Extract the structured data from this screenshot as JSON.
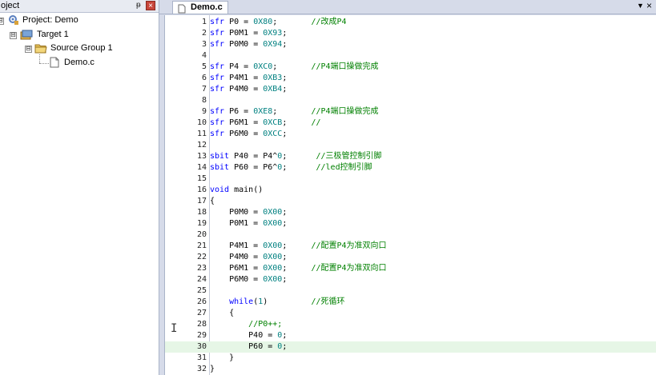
{
  "project_pane": {
    "title": "oject",
    "pin": "ᵽ",
    "close": "×",
    "tree": [
      {
        "label": "Project: Demo",
        "level": 0,
        "icon": "project-icon",
        "expander": "⊟"
      },
      {
        "label": "Target 1",
        "level": 1,
        "icon": "target-icon",
        "expander": "⊟"
      },
      {
        "label": "Source Group 1",
        "level": 2,
        "icon": "folder-icon",
        "expander": "⊟"
      },
      {
        "label": "Demo.c",
        "level": 3,
        "icon": "file-icon"
      }
    ]
  },
  "editor": {
    "tab_label": "Demo.c",
    "tab_menu": "▼",
    "tab_close": "×",
    "highlight_line": 30,
    "lines": [
      {
        "n": "1",
        "toks": [
          [
            "kw",
            "sfr "
          ],
          [
            "txt",
            "P0 = "
          ],
          [
            "num",
            "0X80"
          ],
          [
            "txt",
            ";       "
          ],
          [
            "cmt",
            "//改成P4"
          ]
        ]
      },
      {
        "n": "2",
        "toks": [
          [
            "kw",
            "sfr "
          ],
          [
            "txt",
            "P0M1 = "
          ],
          [
            "num",
            "0X93"
          ],
          [
            "txt",
            ";"
          ]
        ]
      },
      {
        "n": "3",
        "toks": [
          [
            "kw",
            "sfr "
          ],
          [
            "txt",
            "P0M0 = "
          ],
          [
            "num",
            "0X94"
          ],
          [
            "txt",
            ";"
          ]
        ]
      },
      {
        "n": "4",
        "toks": []
      },
      {
        "n": "5",
        "toks": [
          [
            "kw",
            "sfr "
          ],
          [
            "txt",
            "P4 = "
          ],
          [
            "num",
            "0XC0"
          ],
          [
            "txt",
            ";       "
          ],
          [
            "cmt",
            "//P4端口操做完成"
          ]
        ]
      },
      {
        "n": "6",
        "toks": [
          [
            "kw",
            "sfr "
          ],
          [
            "txt",
            "P4M1 = "
          ],
          [
            "num",
            "0XB3"
          ],
          [
            "txt",
            ";"
          ]
        ]
      },
      {
        "n": "7",
        "toks": [
          [
            "kw",
            "sfr "
          ],
          [
            "txt",
            "P4M0 = "
          ],
          [
            "num",
            "0XB4"
          ],
          [
            "txt",
            ";"
          ]
        ]
      },
      {
        "n": "8",
        "toks": []
      },
      {
        "n": "9",
        "toks": [
          [
            "kw",
            "sfr "
          ],
          [
            "txt",
            "P6 = "
          ],
          [
            "num",
            "0XE8"
          ],
          [
            "txt",
            ";       "
          ],
          [
            "cmt",
            "//P4端口操做完成"
          ]
        ]
      },
      {
        "n": "10",
        "toks": [
          [
            "kw",
            "sfr "
          ],
          [
            "txt",
            "P6M1 = "
          ],
          [
            "num",
            "0XCB"
          ],
          [
            "txt",
            ";     "
          ],
          [
            "cmt",
            "//"
          ]
        ]
      },
      {
        "n": "11",
        "toks": [
          [
            "kw",
            "sfr "
          ],
          [
            "txt",
            "P6M0 = "
          ],
          [
            "num",
            "0XCC"
          ],
          [
            "txt",
            ";"
          ]
        ]
      },
      {
        "n": "12",
        "toks": []
      },
      {
        "n": "13",
        "toks": [
          [
            "kw",
            "sbit "
          ],
          [
            "txt",
            "P40 = P4^"
          ],
          [
            "num",
            "0"
          ],
          [
            "txt",
            ";      "
          ],
          [
            "cmt",
            "//三极管控制引脚"
          ]
        ]
      },
      {
        "n": "14",
        "toks": [
          [
            "kw",
            "sbit "
          ],
          [
            "txt",
            "P60 = P6^"
          ],
          [
            "num",
            "0"
          ],
          [
            "txt",
            ";      "
          ],
          [
            "cmt",
            "//led控制引脚"
          ]
        ]
      },
      {
        "n": "15",
        "toks": []
      },
      {
        "n": "16",
        "toks": [
          [
            "kw",
            "void "
          ],
          [
            "txt",
            "main()"
          ]
        ]
      },
      {
        "n": "17",
        "toks": [
          [
            "txt",
            "{"
          ]
        ]
      },
      {
        "n": "18",
        "toks": [
          [
            "txt",
            "    P0M0 = "
          ],
          [
            "num",
            "0X00"
          ],
          [
            "txt",
            ";"
          ]
        ]
      },
      {
        "n": "19",
        "toks": [
          [
            "txt",
            "    P0M1 = "
          ],
          [
            "num",
            "0X00"
          ],
          [
            "txt",
            ";"
          ]
        ]
      },
      {
        "n": "20",
        "toks": []
      },
      {
        "n": "21",
        "toks": [
          [
            "txt",
            "    P4M1 = "
          ],
          [
            "num",
            "0X00"
          ],
          [
            "txt",
            ";     "
          ],
          [
            "cmt",
            "//配置P4为准双向口"
          ]
        ]
      },
      {
        "n": "22",
        "toks": [
          [
            "txt",
            "    P4M0 = "
          ],
          [
            "num",
            "0X00"
          ],
          [
            "txt",
            ";"
          ]
        ]
      },
      {
        "n": "23",
        "toks": [
          [
            "txt",
            "    P6M1 = "
          ],
          [
            "num",
            "0X00"
          ],
          [
            "txt",
            ";     "
          ],
          [
            "cmt",
            "//配置P4为准双向口"
          ]
        ]
      },
      {
        "n": "24",
        "toks": [
          [
            "txt",
            "    P6M0 = "
          ],
          [
            "num",
            "0X00"
          ],
          [
            "txt",
            ";"
          ]
        ]
      },
      {
        "n": "25",
        "toks": []
      },
      {
        "n": "26",
        "toks": [
          [
            "txt",
            "    "
          ],
          [
            "kw",
            "while"
          ],
          [
            "txt",
            "("
          ],
          [
            "num",
            "1"
          ],
          [
            "txt",
            ")         "
          ],
          [
            "cmt",
            "//死循环"
          ]
        ]
      },
      {
        "n": "27",
        "toks": [
          [
            "txt",
            "    {"
          ]
        ]
      },
      {
        "n": "28",
        "toks": [
          [
            "txt",
            "        "
          ],
          [
            "cmt",
            "//P0++;"
          ]
        ]
      },
      {
        "n": "29",
        "toks": [
          [
            "txt",
            "        P40 = "
          ],
          [
            "num",
            "0"
          ],
          [
            "txt",
            ";"
          ]
        ]
      },
      {
        "n": "30",
        "toks": [
          [
            "txt",
            "        P60 = "
          ],
          [
            "num",
            "0"
          ],
          [
            "txt",
            ";"
          ]
        ]
      },
      {
        "n": "31",
        "toks": [
          [
            "txt",
            "    }"
          ]
        ]
      },
      {
        "n": "32",
        "toks": [
          [
            "txt",
            "}"
          ]
        ]
      }
    ]
  }
}
